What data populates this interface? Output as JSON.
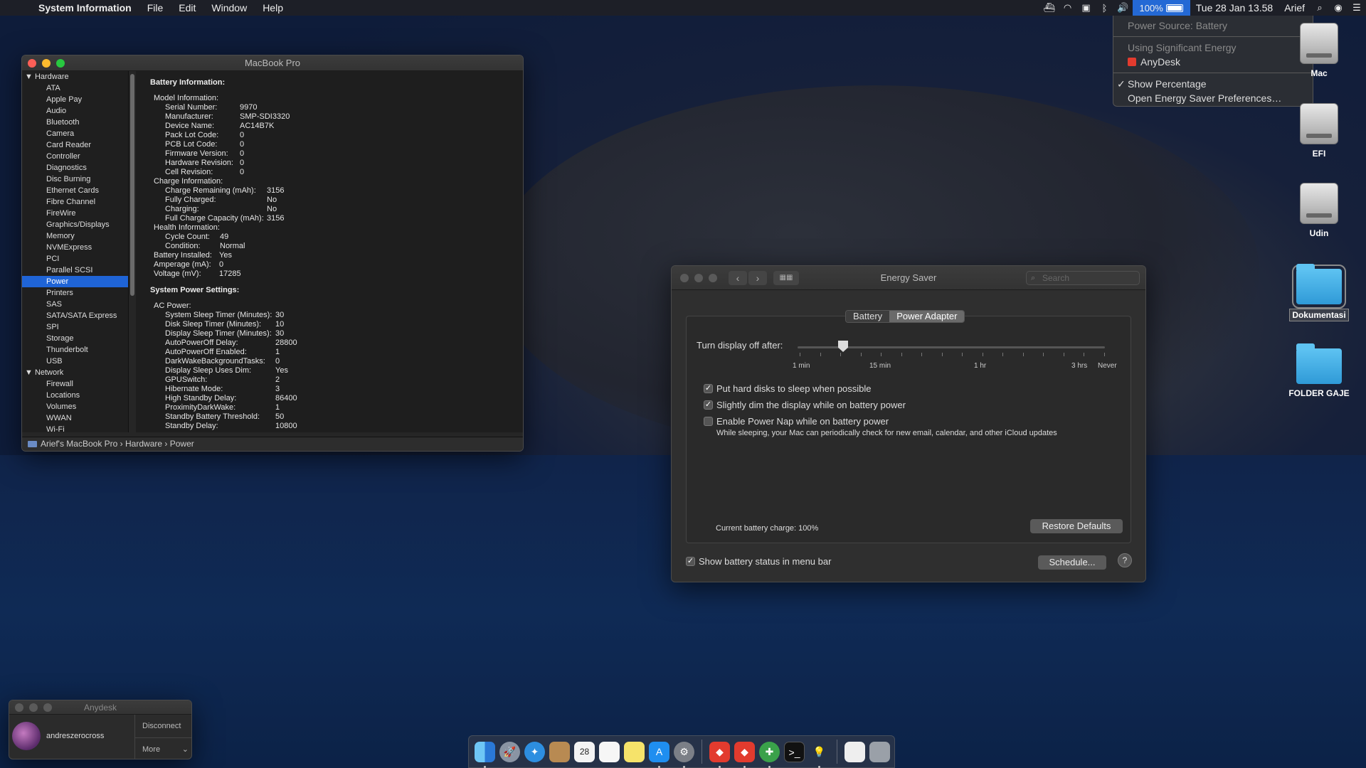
{
  "menubar": {
    "app_name": "System Information",
    "menus": [
      "File",
      "Edit",
      "Window",
      "Help"
    ],
    "battery_percent": "100%",
    "datetime": "Tue 28 Jan  13.58",
    "user": "Arief"
  },
  "battery_menu": {
    "power_source": "Power Source: Battery",
    "using_energy": "Using Significant Energy",
    "app": "AnyDesk",
    "show_percentage": "Show Percentage",
    "open_prefs": "Open Energy Saver Preferences…",
    "check": "✓"
  },
  "desktop": {
    "icons": [
      {
        "label": "Mac"
      },
      {
        "label": "EFI"
      },
      {
        "label": "Udin"
      },
      {
        "label": "Dokumentasi"
      },
      {
        "label": "FOLDER GAJE"
      }
    ]
  },
  "sysinfo": {
    "title": "MacBook Pro",
    "sidebar": {
      "hardware": "▼ Hardware",
      "hardware_items": [
        "ATA",
        "Apple Pay",
        "Audio",
        "Bluetooth",
        "Camera",
        "Card Reader",
        "Controller",
        "Diagnostics",
        "Disc Burning",
        "Ethernet Cards",
        "Fibre Channel",
        "FireWire",
        "Graphics/Displays",
        "Memory",
        "NVMExpress",
        "PCI",
        "Parallel SCSI",
        "Power",
        "Printers",
        "SAS",
        "SATA/SATA Express",
        "SPI",
        "Storage",
        "Thunderbolt",
        "USB"
      ],
      "network": "▼ Network",
      "network_items": [
        "Firewall",
        "Locations",
        "Volumes",
        "WWAN",
        "Wi-Fi"
      ]
    },
    "content": {
      "battery_heading": "Battery Information:",
      "battery_lines": [
        {
          "k": "Model Information:",
          "v": "",
          "indent": 0,
          "vx": 0
        },
        {
          "k": "Serial Number:",
          "v": "9970",
          "indent": 1,
          "vx": 105
        },
        {
          "k": "Manufacturer:",
          "v": "SMP-SDI3320",
          "indent": 1,
          "vx": 105
        },
        {
          "k": "Device Name:",
          "v": "AC14B7K",
          "indent": 1,
          "vx": 105
        },
        {
          "k": "Pack Lot Code:",
          "v": "0",
          "indent": 1,
          "vx": 105
        },
        {
          "k": "PCB Lot Code:",
          "v": "0",
          "indent": 1,
          "vx": 105
        },
        {
          "k": "Firmware Version:",
          "v": "0",
          "indent": 1,
          "vx": 105
        },
        {
          "k": "Hardware Revision:",
          "v": "0",
          "indent": 1,
          "vx": 105
        },
        {
          "k": "Cell Revision:",
          "v": "0",
          "indent": 1,
          "vx": 105
        },
        {
          "k": "Charge Information:",
          "v": "",
          "indent": 0,
          "vx": 0
        },
        {
          "k": "Charge Remaining (mAh):",
          "v": "3156",
          "indent": 1,
          "vx": 143
        },
        {
          "k": "Fully Charged:",
          "v": "No",
          "indent": 1,
          "vx": 143
        },
        {
          "k": "Charging:",
          "v": "No",
          "indent": 1,
          "vx": 143
        },
        {
          "k": "Full Charge Capacity (mAh):",
          "v": "3156",
          "indent": 1,
          "vx": 143
        },
        {
          "k": "Health Information:",
          "v": "",
          "indent": 0,
          "vx": 0
        },
        {
          "k": "Cycle Count:",
          "v": "49",
          "indent": 1,
          "vx": 77
        },
        {
          "k": "Condition:",
          "v": "Normal",
          "indent": 1,
          "vx": 77
        },
        {
          "k": "Battery Installed:",
          "v": "Yes",
          "indent": 0,
          "vx": 92
        },
        {
          "k": "Amperage (mA):",
          "v": "0",
          "indent": 0,
          "vx": 92
        },
        {
          "k": "Voltage (mV):",
          "v": "17285",
          "indent": 0,
          "vx": 92
        }
      ],
      "power_heading": "System Power Settings:",
      "power_lines": [
        {
          "k": "AC Power:",
          "v": "",
          "indent": 0,
          "vx": 0
        },
        {
          "k": "System Sleep Timer (Minutes):",
          "v": "30",
          "indent": 1,
          "vx": 155
        },
        {
          "k": "Disk Sleep Timer (Minutes):",
          "v": "10",
          "indent": 1,
          "vx": 155
        },
        {
          "k": "Display Sleep Timer (Minutes):",
          "v": "30",
          "indent": 1,
          "vx": 155
        },
        {
          "k": "AutoPowerOff Delay:",
          "v": "28800",
          "indent": 1,
          "vx": 155
        },
        {
          "k": "AutoPowerOff Enabled:",
          "v": "1",
          "indent": 1,
          "vx": 155
        },
        {
          "k": "DarkWakeBackgroundTasks:",
          "v": "0",
          "indent": 1,
          "vx": 155
        },
        {
          "k": "Display Sleep Uses Dim:",
          "v": "Yes",
          "indent": 1,
          "vx": 155
        },
        {
          "k": "GPUSwitch:",
          "v": "2",
          "indent": 1,
          "vx": 155
        },
        {
          "k": "Hibernate Mode:",
          "v": "3",
          "indent": 1,
          "vx": 155
        },
        {
          "k": "High Standby Delay:",
          "v": "86400",
          "indent": 1,
          "vx": 155
        },
        {
          "k": "ProximityDarkWake:",
          "v": "1",
          "indent": 1,
          "vx": 155
        },
        {
          "k": "Standby Battery Threshold:",
          "v": "50",
          "indent": 1,
          "vx": 155
        },
        {
          "k": "Standby Delay:",
          "v": "10800",
          "indent": 1,
          "vx": 155
        }
      ]
    },
    "pathbar": {
      "computer": "Arief's MacBook Pro",
      "sep": "›",
      "section": "Hardware",
      "item": "Power"
    }
  },
  "energy": {
    "title": "Energy Saver",
    "search_placeholder": "Search",
    "tabs": [
      "Battery",
      "Power Adapter"
    ],
    "active_tab": "Power Adapter",
    "turn_display_off": "Turn display off after:",
    "slider_labels": [
      "1 min",
      "15 min",
      "1 hr",
      "3 hrs",
      "Never"
    ],
    "options": [
      {
        "label": "Put hard disks to sleep when possible",
        "checked": true
      },
      {
        "label": "Slightly dim the display while on battery power",
        "checked": true
      },
      {
        "label": "Enable Power Nap while on battery power",
        "checked": false
      }
    ],
    "powernap_desc": "While sleeping, your Mac can periodically check for new email, calendar, and other iCloud updates",
    "battery_charge": "Current battery charge: 100%",
    "restore_defaults": "Restore Defaults",
    "show_status": "Show battery status in menu bar",
    "schedule": "Schedule...",
    "help": "?"
  },
  "anydesk": {
    "title": "Anydesk",
    "user": "andreszerocross",
    "disconnect": "Disconnect",
    "more": "More"
  },
  "dock": {
    "calendar_day": "28"
  }
}
